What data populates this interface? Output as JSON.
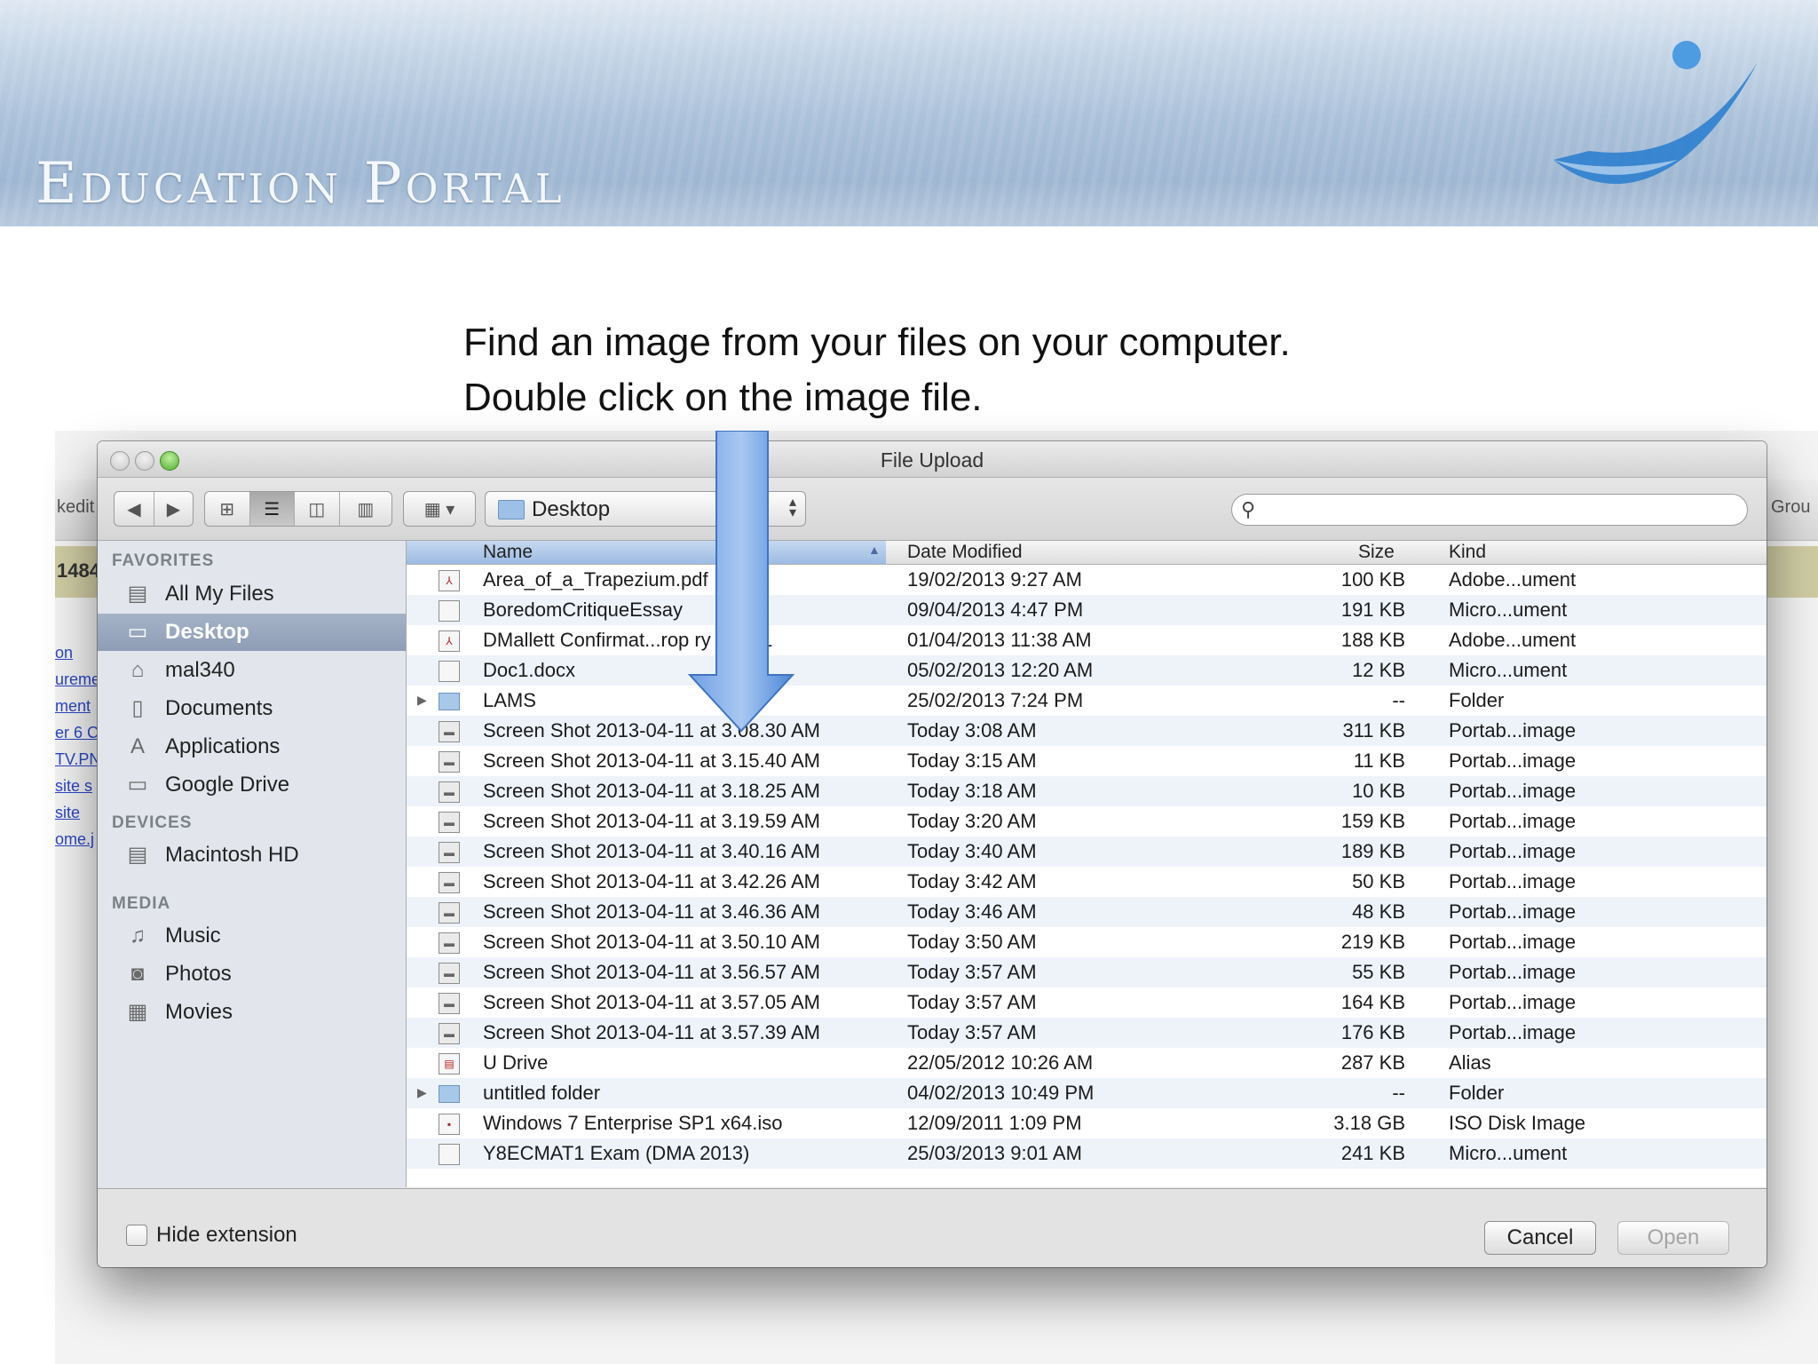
{
  "banner": {
    "title": "Education Portal"
  },
  "instructions": {
    "line1": "Find an image from your files on your computer.",
    "line2": "Double click on the image file."
  },
  "background_page": {
    "toolbar_left_text": "kedit",
    "toolbar_right_text": "Grou",
    "olive_bar_text": "1484",
    "links": [
      "on",
      "ureme",
      "ment",
      "er 6 C",
      "TV.PN",
      "site s",
      "site",
      "ome.j"
    ]
  },
  "dialog": {
    "title": "File Upload",
    "location": "Desktop",
    "search": {
      "placeholder": "",
      "value": ""
    },
    "sidebar": {
      "favorites_heading": "FAVORITES",
      "favorites": [
        {
          "label": "All My Files",
          "icon": "all-files-icon"
        },
        {
          "label": "Desktop",
          "icon": "desktop-icon",
          "selected": true
        },
        {
          "label": "mal340",
          "icon": "home-icon"
        },
        {
          "label": "Documents",
          "icon": "documents-icon"
        },
        {
          "label": "Applications",
          "icon": "applications-icon"
        },
        {
          "label": "Google Drive",
          "icon": "folder-icon"
        }
      ],
      "devices_heading": "DEVICES",
      "devices": [
        {
          "label": "Macintosh HD",
          "icon": "hard-drive-icon"
        }
      ],
      "media_heading": "MEDIA",
      "media": [
        {
          "label": "Music",
          "icon": "music-icon"
        },
        {
          "label": "Photos",
          "icon": "camera-icon"
        },
        {
          "label": "Movies",
          "icon": "film-icon"
        }
      ]
    },
    "columns": {
      "name": "Name",
      "date": "Date Modified",
      "size": "Size",
      "kind": "Kind"
    },
    "files": [
      {
        "name": "Area_of_a_Trapezium.pdf",
        "date": "19/02/2013 9:27 AM",
        "size": "100 KB",
        "kind": "Adobe...ument",
        "type": "pdf"
      },
      {
        "name": "BoredomCritiqueEssay",
        "date": "09/04/2013 4:47 PM",
        "size": "191 KB",
        "kind": "Micro...ument",
        "type": "doc"
      },
      {
        "name": "DMallett Confirmat...rop        ry 4 Apr1",
        "date": "01/04/2013 11:38 AM",
        "size": "188 KB",
        "kind": "Adobe...ument",
        "type": "pdf"
      },
      {
        "name": "Doc1.docx",
        "date": "05/02/2013 12:20 AM",
        "size": "12 KB",
        "kind": "Micro...ument",
        "type": "doc"
      },
      {
        "name": "LAMS",
        "date": "25/02/2013 7:24 PM",
        "size": "--",
        "kind": "Folder",
        "type": "folder"
      },
      {
        "name": "Screen Shot 2013-04-11 at 3.08.30 AM",
        "date": "Today 3:08 AM",
        "size": "311 KB",
        "kind": "Portab...image",
        "type": "img"
      },
      {
        "name": "Screen Shot 2013-04-11 at 3.15.40 AM",
        "date": "Today 3:15 AM",
        "size": "11 KB",
        "kind": "Portab...image",
        "type": "img"
      },
      {
        "name": "Screen Shot 2013-04-11 at 3.18.25 AM",
        "date": "Today 3:18 AM",
        "size": "10 KB",
        "kind": "Portab...image",
        "type": "img"
      },
      {
        "name": "Screen Shot 2013-04-11 at 3.19.59 AM",
        "date": "Today 3:20 AM",
        "size": "159 KB",
        "kind": "Portab...image",
        "type": "img"
      },
      {
        "name": "Screen Shot 2013-04-11 at 3.40.16 AM",
        "date": "Today 3:40 AM",
        "size": "189 KB",
        "kind": "Portab...image",
        "type": "img"
      },
      {
        "name": "Screen Shot 2013-04-11 at 3.42.26 AM",
        "date": "Today 3:42 AM",
        "size": "50 KB",
        "kind": "Portab...image",
        "type": "img"
      },
      {
        "name": "Screen Shot 2013-04-11 at 3.46.36 AM",
        "date": "Today 3:46 AM",
        "size": "48 KB",
        "kind": "Portab...image",
        "type": "img"
      },
      {
        "name": "Screen Shot 2013-04-11 at 3.50.10 AM",
        "date": "Today 3:50 AM",
        "size": "219 KB",
        "kind": "Portab...image",
        "type": "img"
      },
      {
        "name": "Screen Shot 2013-04-11 at 3.56.57 AM",
        "date": "Today 3:57 AM",
        "size": "55 KB",
        "kind": "Portab...image",
        "type": "img"
      },
      {
        "name": "Screen Shot 2013-04-11 at 3.57.05 AM",
        "date": "Today 3:57 AM",
        "size": "164 KB",
        "kind": "Portab...image",
        "type": "img"
      },
      {
        "name": "Screen Shot 2013-04-11 at 3.57.39 AM",
        "date": "Today 3:57 AM",
        "size": "176 KB",
        "kind": "Portab...image",
        "type": "img"
      },
      {
        "name": "U Drive",
        "date": "22/05/2012 10:26 AM",
        "size": "287 KB",
        "kind": "Alias",
        "type": "alias"
      },
      {
        "name": "untitled folder",
        "date": "04/02/2013 10:49 PM",
        "size": "--",
        "kind": "Folder",
        "type": "folder"
      },
      {
        "name": "Windows 7 Enterprise SP1 x64.iso",
        "date": "12/09/2011 1:09 PM",
        "size": "3.18 GB",
        "kind": "ISO Disk Image",
        "type": "iso"
      },
      {
        "name": "Y8ECMAT1 Exam (DMA 2013)",
        "date": "25/03/2013 9:01 AM",
        "size": "241 KB",
        "kind": "Micro...ument",
        "type": "doc"
      }
    ],
    "hide_extension_label": "Hide extension",
    "cancel_label": "Cancel",
    "open_label": "Open"
  },
  "colors": {
    "selection": "#8e9db5",
    "arrow": "#4d87d8",
    "header_sort": "#9dbbe3"
  }
}
